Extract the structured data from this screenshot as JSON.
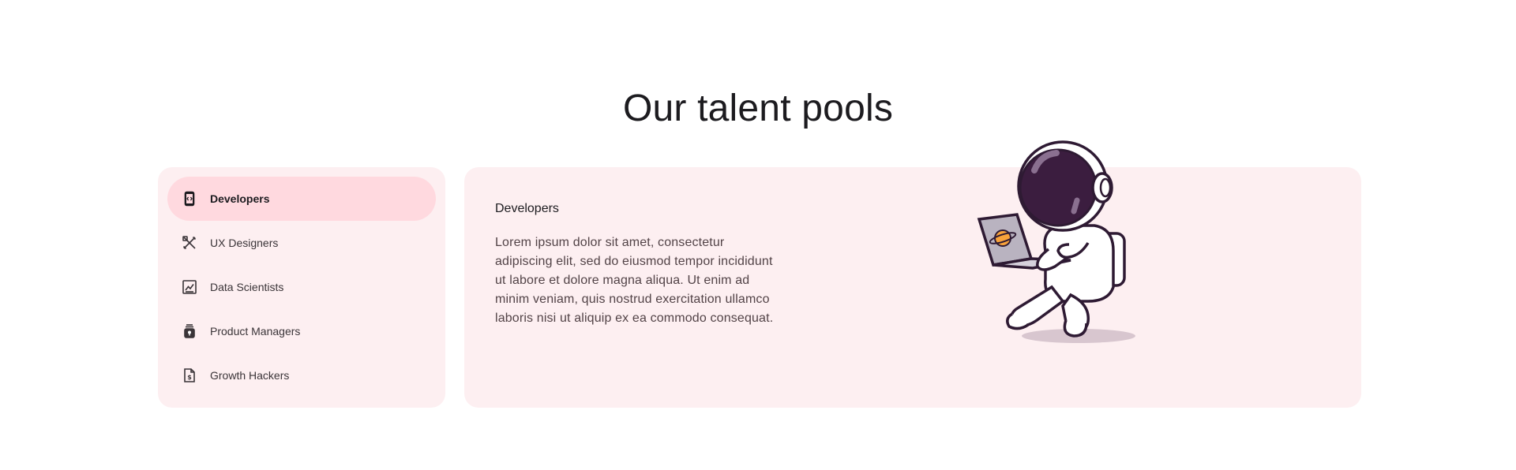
{
  "page": {
    "title": "Our talent pools"
  },
  "nav": {
    "items": [
      {
        "label": "Developers",
        "icon": "code-device-icon",
        "active": true
      },
      {
        "label": "UX Designers",
        "icon": "design-tools-icon",
        "active": false
      },
      {
        "label": "Data Scientists",
        "icon": "chart-icon",
        "active": false
      },
      {
        "label": "Product Managers",
        "icon": "product-icon",
        "active": false
      },
      {
        "label": "Growth Hackers",
        "icon": "dollar-document-icon",
        "active": false
      }
    ]
  },
  "content": {
    "title": "Developers",
    "body": "Lorem ipsum dolor sit amet, consectetur adipiscing elit, sed do eiusmod tempor incididunt ut labore et dolore magna aliqua. Ut enim ad minim veniam, quis nostrud exercitation ullamco laboris nisi ut aliquip ex ea commodo consequat.",
    "illustration": "astronaut-with-laptop"
  },
  "colors": {
    "card_bg": "#fdeff1",
    "active_bg": "#ffd9df",
    "title_text": "#1c1b1f",
    "body_text": "#524347",
    "helmet_visor": "#3b1d3f",
    "planet_accent": "#f7a23a"
  }
}
